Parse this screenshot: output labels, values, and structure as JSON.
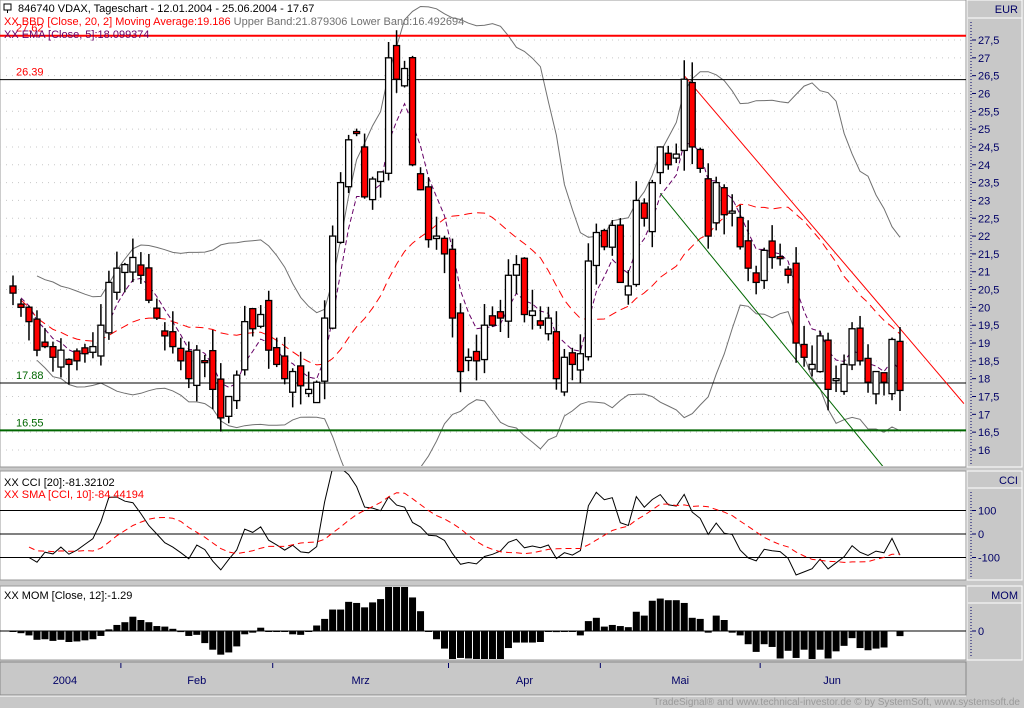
{
  "header": {
    "title": "846740  VDAX, Tageschart - 12.01.2004 - 25.06.2004 - 17.67",
    "bbd_prefix": "XX BBD [Close, 20, 2] Moving Average:19.186",
    "bbd_bands": "Upper Band:21.879306 Lower Band:16.492694",
    "ema": "XX EMA [Close, 5]:18.099374",
    "cci": "XX CCI [20]:-81.32102",
    "cci_sma": "XX SMA [CCI, 10]:-84.44194",
    "mom": "XX MOM [Close, 12]:-1.29"
  },
  "axis_titles": {
    "price": "EUR",
    "cci": "CCI",
    "mom": "MOM"
  },
  "footer": "TradeSignal® and www.technical-investor.de © by  SystemSoft, www.systemsoft.de",
  "colors": {
    "up": "#ffffff",
    "down": "#ff0000",
    "ma": "#ff0000",
    "ema": "#660066",
    "band": "#707070",
    "support": "#006600",
    "resistance": "#ff0000",
    "axis_text": "#000066"
  },
  "chart_data": {
    "type": "candlestick",
    "title": "846740 VDAX, Tageschart - 12.01.2004 - 25.06.2004",
    "ylabel": "EUR",
    "ylim": [
      15.6,
      27.8
    ],
    "price_ticks": [
      [
        "27,5",
        27.5
      ],
      [
        "27",
        27
      ],
      [
        "26,5",
        26.5
      ],
      [
        "26",
        26
      ],
      [
        "25,5",
        25.5
      ],
      [
        "25",
        25
      ],
      [
        "24,5",
        24.5
      ],
      [
        "24",
        24
      ],
      [
        "23,5",
        23.5
      ],
      [
        "23",
        23
      ],
      [
        "22,5",
        22.5
      ],
      [
        "22",
        22
      ],
      [
        "21,5",
        21.5
      ],
      [
        "21",
        21
      ],
      [
        "20,5",
        20.5
      ],
      [
        "20",
        20
      ],
      [
        "19,5",
        19.5
      ],
      [
        "19",
        19
      ],
      [
        "18,5",
        18.5
      ],
      [
        "18",
        18
      ],
      [
        "17,5",
        17.5
      ],
      [
        "17",
        17
      ],
      [
        "16,5",
        16.5
      ],
      [
        "16",
        16
      ]
    ],
    "months": [
      [
        "2004",
        0
      ],
      [
        "Feb",
        14
      ],
      [
        "Mrz",
        33
      ],
      [
        "Apr",
        55
      ],
      [
        "Mai",
        74
      ],
      [
        "Jun",
        94
      ]
    ],
    "month_ticks": [
      13.5,
      32.5,
      54.5,
      73.5,
      93.5
    ],
    "closes": [
      20.4,
      20.0,
      19.6,
      18.8,
      18.9,
      18.6,
      18.8,
      18.4,
      18.5,
      18.7,
      18.9,
      19.5,
      20.7,
      21.1,
      21.2,
      21.4,
      20.9,
      20.2,
      19.7,
      19.2,
      18.9,
      18.5,
      18.0,
      18.8,
      18.5,
      17.7,
      16.9,
      17.5,
      18.1,
      19.6,
      19.4,
      19.8,
      18.8,
      18.4,
      18.0,
      18.2,
      17.8,
      17.7,
      17.9,
      19.7,
      22.0,
      23.5,
      24.7,
      24.9,
      23.1,
      23.6,
      23.8,
      27.0,
      26.4,
      26.7,
      24.0,
      23.3,
      21.9,
      22.0,
      21.5,
      19.7,
      18.2,
      18.6,
      18.5,
      19.5,
      19.5,
      19.7,
      20.9,
      21.2,
      19.8,
      19.9,
      19.5,
      19.7,
      18.0,
      18.6,
      18.4,
      18.7,
      21.3,
      22.1,
      21.7,
      22.3,
      20.7,
      20.6,
      23.0,
      22.5,
      23.5,
      24.5,
      24.0,
      24.3,
      26.4,
      24.5,
      23.9,
      22.0,
      23.5,
      22.6,
      22.7,
      21.7,
      21.1,
      20.7,
      21.6,
      21.4,
      21.4,
      20.9,
      19.0,
      18.6,
      18.4,
      19.2,
      17.7,
      18.0,
      18.4,
      19.4,
      18.5,
      17.9,
      18.2,
      17.9,
      19.1,
      17.67
    ],
    "hlines": [
      {
        "label": "27.62",
        "value": 27.62,
        "color": "#ff0000"
      },
      {
        "label": "26.39",
        "value": 26.39,
        "color": "#000000",
        "label_color": "#ff0000"
      },
      {
        "label": "17.88",
        "value": 17.88,
        "color": "#000000",
        "label_color": "#006600"
      },
      {
        "label": "16.55",
        "value": 16.55,
        "color": "#006600"
      }
    ],
    "trendlines": [
      {
        "name": "resistance-trendline",
        "from": [
          84,
          26.5
        ],
        "to": [
          119,
          17.3
        ],
        "color": "#ff0000"
      },
      {
        "name": "support-trendline",
        "from": [
          81,
          23.2
        ],
        "to": [
          109,
          15.5
        ],
        "color": "#006600"
      }
    ],
    "cci_ticks": [
      [
        "100",
        100
      ],
      [
        "0",
        0
      ],
      [
        "-100",
        -100
      ]
    ],
    "mom_ticks": [
      [
        "0",
        0
      ]
    ]
  }
}
